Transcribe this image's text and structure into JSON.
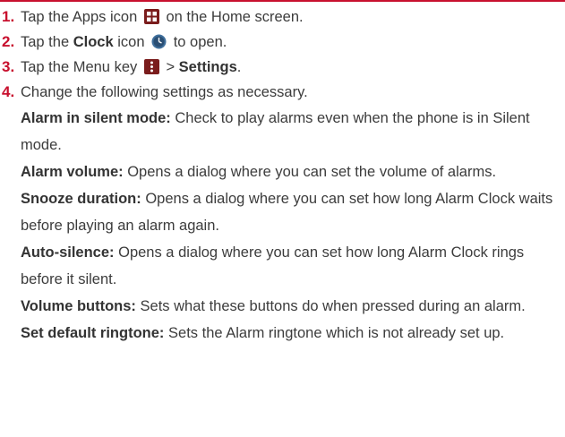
{
  "colors": {
    "accent": "#c8102e",
    "text": "#3c3c3c"
  },
  "steps": [
    {
      "number": "1.",
      "pre": "Tap the Apps icon",
      "icon": "apps-grid-icon",
      "post": "on the Home screen."
    },
    {
      "number": "2.",
      "pre": "Tap the ",
      "bold": "Clock",
      "mid": " icon",
      "icon": "clock-icon",
      "post": "to open."
    },
    {
      "number": "3.",
      "pre": "Tap the Menu key",
      "icon": "menu-key-icon",
      "post": "> ",
      "bold": "Settings",
      "end": "."
    },
    {
      "number": "4.",
      "text": "Change the following settings as necessary."
    }
  ],
  "settings": [
    {
      "name": "Alarm in silent mode:",
      "description": "Check to play alarms even when the phone is in Silent mode."
    },
    {
      "name": "Alarm volume:",
      "description": "Opens a dialog where you can set the volume of alarms."
    },
    {
      "name": "Snooze duration:",
      "description": "Opens a dialog where you can set how long Alarm Clock waits before playing an alarm again."
    },
    {
      "name": "Auto-silence:",
      "description": "Opens a dialog where you can set how long Alarm Clock rings before it silent."
    },
    {
      "name": "Volume buttons:",
      "description": "Sets what these buttons do when pressed during an alarm."
    },
    {
      "name": "Set default ringtone:",
      "description": "Sets the Alarm ringtone which is not  already set up."
    }
  ]
}
